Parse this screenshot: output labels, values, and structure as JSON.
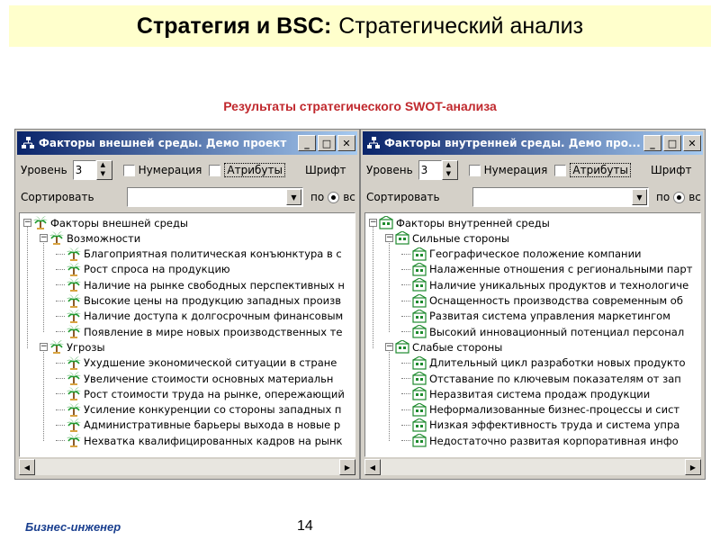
{
  "slide": {
    "title_bold": "Стратегия и BSC:",
    "title_rest": "Стратегический анализ",
    "subtitle": "Результаты стратегического SWOT-анализа",
    "footer_brand": "Бизнес-инженер",
    "page_number": "14"
  },
  "colors": {
    "title_bg": "#ffffcc",
    "subtitle": "#c0282d",
    "window_caption": "#0a246a",
    "footer_text": "#1a3f8f"
  },
  "caption_buttons": [
    "_",
    "□",
    "✕"
  ],
  "windows": [
    {
      "id": "external",
      "caption": "Факторы внешней среды. Демо проект",
      "level_label": "Уровень",
      "level_value": "3",
      "numbering_label": "Нумерация",
      "attributes_label": "Атрибуты",
      "font_label": "Шрифт",
      "sort_label": "Сортировать",
      "sort_value": "",
      "by_label": "по",
      "radio_label": "вс",
      "tree_icon": "palm-tree-icon",
      "tree": [
        {
          "text": "Факторы внешней среды",
          "level": 0,
          "toggle": "minus"
        },
        {
          "text": "Возможности",
          "level": 1,
          "toggle": "minus"
        },
        {
          "text": "Благоприятная политическая конъюнктура в с",
          "level": 2
        },
        {
          "text": "Рост спроса на продукцию",
          "level": 2
        },
        {
          "text": "Наличие на рынке свободных перспективных н",
          "level": 2
        },
        {
          "text": "Высокие цены на продукцию западных произв",
          "level": 2
        },
        {
          "text": "Наличие доступа к долгосрочным финансовым",
          "level": 2
        },
        {
          "text": "Появление в мире новых производственных те",
          "level": 2
        },
        {
          "text": "Угрозы",
          "level": 1,
          "toggle": "minus"
        },
        {
          "text": "Ухудшение экономической ситуации в стране",
          "level": 2
        },
        {
          "text": "Увеличение стоимости основных материальн",
          "level": 2
        },
        {
          "text": "Рост стоимости труда на рынке, опережающий",
          "level": 2
        },
        {
          "text": "Усиление конкуренции со стороны западных п",
          "level": 2
        },
        {
          "text": "Административные барьеры выхода в новые р",
          "level": 2
        },
        {
          "text": "Нехватка квалифицированных кадров на рынк",
          "level": 2
        }
      ]
    },
    {
      "id": "internal",
      "caption": "Факторы внутренней среды. Демо про...",
      "level_label": "Уровень",
      "level_value": "3",
      "numbering_label": "Нумерация",
      "attributes_label": "Атрибуты",
      "font_label": "Шрифт",
      "sort_label": "Сортировать",
      "sort_value": "",
      "by_label": "по",
      "radio_label": "вс",
      "tree_icon": "green-building-icon",
      "tree": [
        {
          "text": "Факторы внутренней среды",
          "level": 0,
          "toggle": "minus"
        },
        {
          "text": "Сильные стороны",
          "level": 1,
          "toggle": "minus"
        },
        {
          "text": "Географическое положение компании",
          "level": 2
        },
        {
          "text": "Налаженные отношения с региональными парт",
          "level": 2
        },
        {
          "text": "Наличие уникальных продуктов и технологиче",
          "level": 2
        },
        {
          "text": "Оснащенность производства современным об",
          "level": 2
        },
        {
          "text": "Развитая система управления маркетингом",
          "level": 2
        },
        {
          "text": "Высокий инновационный потенциал персонал",
          "level": 2
        },
        {
          "text": "Слабые стороны",
          "level": 1,
          "toggle": "minus"
        },
        {
          "text": "Длительный цикл разработки новых продукто",
          "level": 2
        },
        {
          "text": "Отставание по ключевым показателям от зап",
          "level": 2
        },
        {
          "text": "Неразвитая система продаж продукции",
          "level": 2
        },
        {
          "text": "Неформализованные бизнес-процессы и сист",
          "level": 2
        },
        {
          "text": "Низкая эффективность труда и система упра",
          "level": 2
        },
        {
          "text": "Недостаточно развитая корпоративная инфо",
          "level": 2
        }
      ]
    }
  ]
}
